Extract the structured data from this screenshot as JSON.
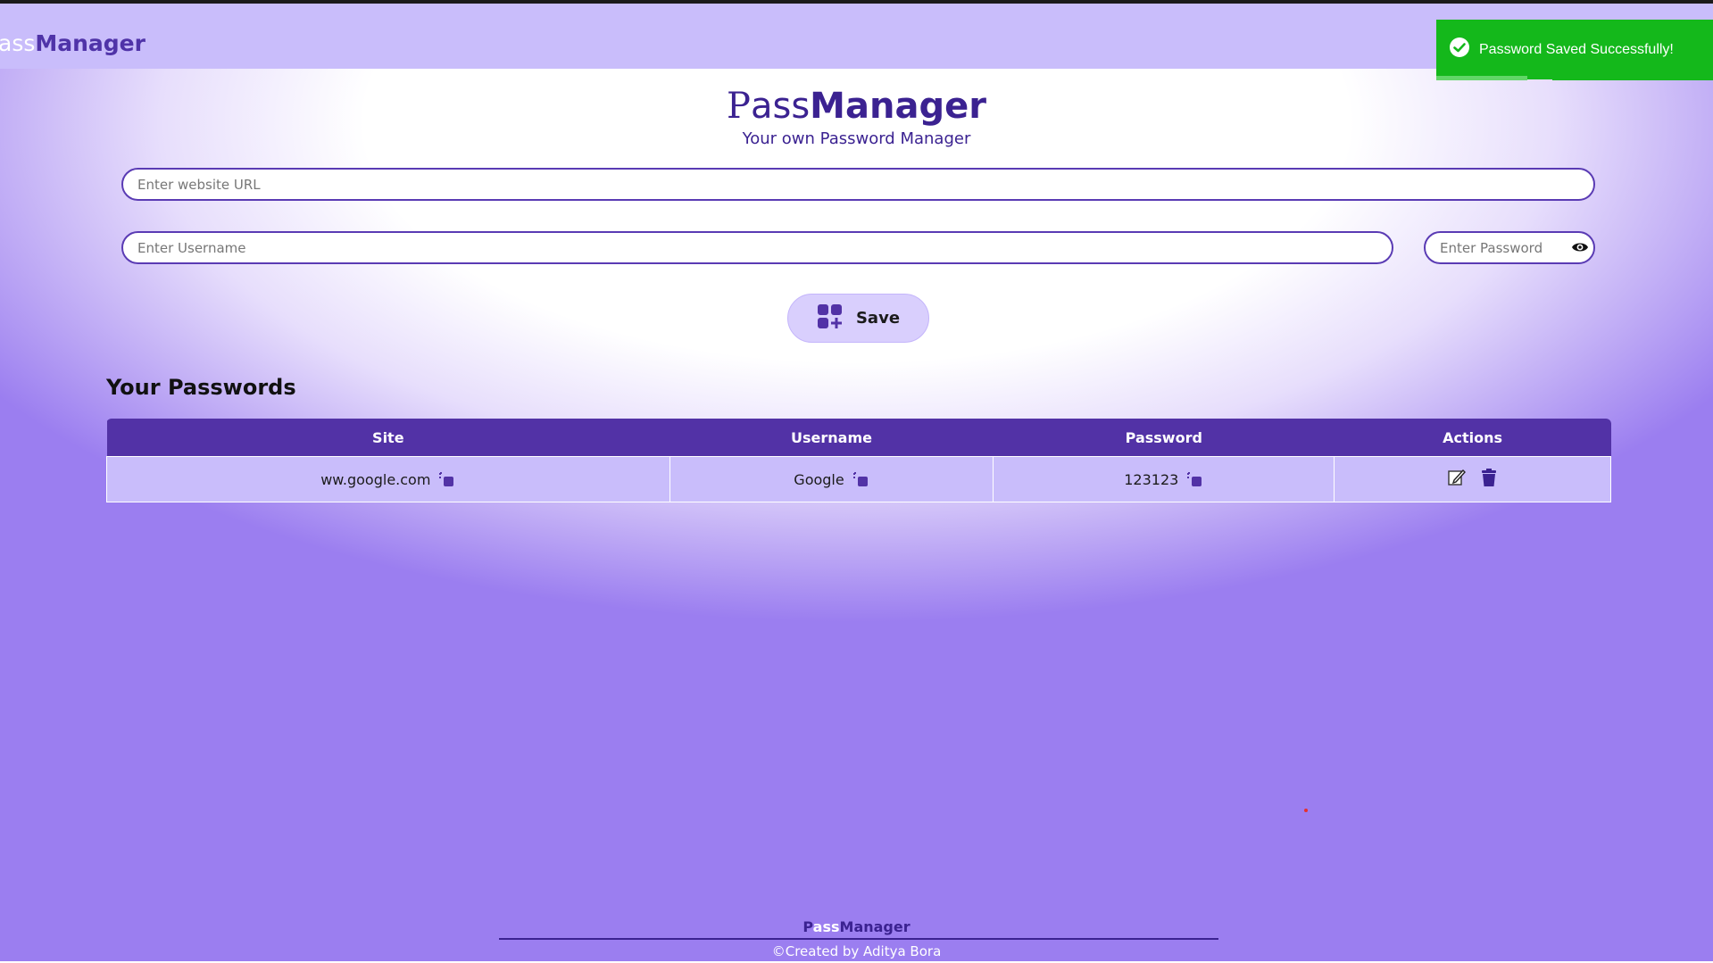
{
  "navbar": {
    "brand_light": "ass",
    "brand_bold": "Manager"
  },
  "header": {
    "logo_p": "P",
    "logo_ass": "ass",
    "logo_manager": "Manager",
    "tagline": "Your own Password Manager"
  },
  "form": {
    "url_placeholder": "Enter website URL",
    "username_placeholder": "Enter Username",
    "password_placeholder": "Enter Password",
    "eye_icon": "eye-icon",
    "save_label": "Save",
    "save_icon": "add-grid-icon"
  },
  "passwords": {
    "title": "Your Passwords",
    "columns": [
      "Site",
      "Username",
      "Password",
      "Actions"
    ],
    "rows": [
      {
        "site": "ww.google.com",
        "username": "Google",
        "password": "123123",
        "actions": [
          "edit-icon",
          "trash-icon"
        ]
      }
    ]
  },
  "toast": {
    "message": "Password Saved Successfully!",
    "icon": "check-circle-icon",
    "progress": 0.33,
    "color": "#14b81b"
  },
  "footer": {
    "brand_p": "P",
    "brand_ass": "ass",
    "brand_manager": "Manager",
    "credit": "©Created by Aditya Bora"
  },
  "colors": {
    "accent": "#5232a6",
    "navbar": "#c9bdfb",
    "row": "#c9bdfb"
  }
}
